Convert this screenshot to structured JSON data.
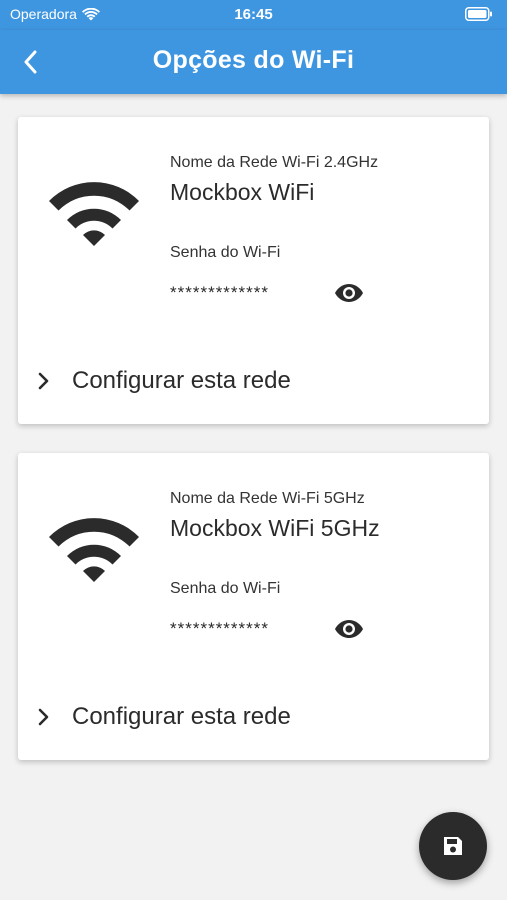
{
  "status_bar": {
    "carrier": "Operadora",
    "time": "16:45"
  },
  "app_bar": {
    "title": "Opções do Wi-Fi"
  },
  "networks": [
    {
      "name_label": "Nome da Rede Wi-Fi 2.4GHz",
      "name": "Mockbox WiFi",
      "password_label": "Senha do Wi-Fi",
      "password": "*************",
      "configure_label": "Configurar esta rede"
    },
    {
      "name_label": "Nome da Rede Wi-Fi 5GHz",
      "name": "Mockbox WiFi 5GHz",
      "password_label": "Senha do Wi-Fi",
      "password": "*************",
      "configure_label": "Configurar esta rede"
    }
  ],
  "fab": {
    "icon": "save-icon"
  },
  "colors": {
    "primary": "#3f96e0",
    "background": "#f2f2f2",
    "fab": "#2b2b2b"
  }
}
